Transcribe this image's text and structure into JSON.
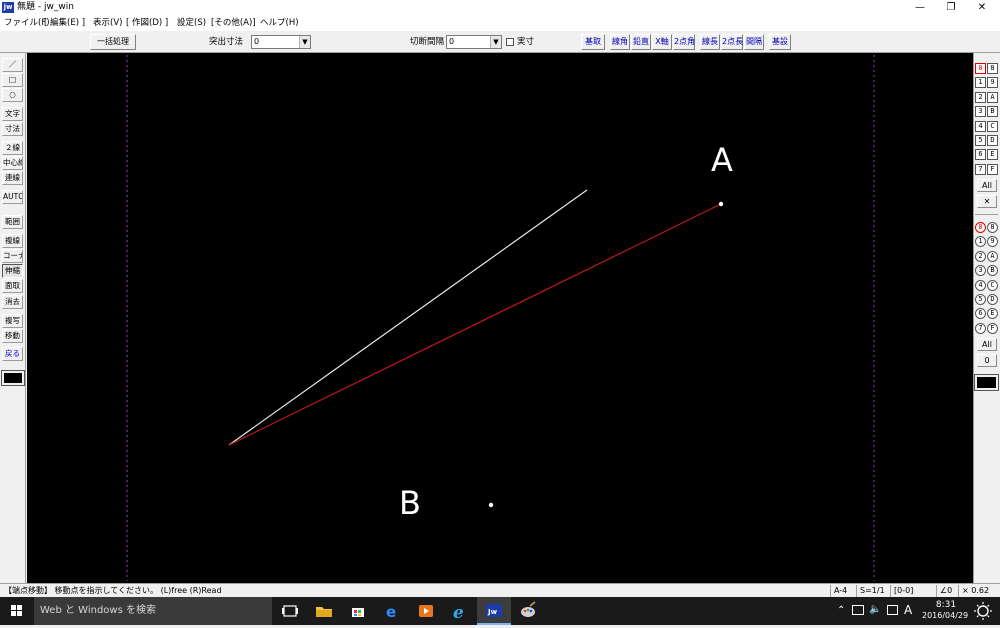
{
  "window": {
    "title": "無題 - jw_win",
    "app_icon_text": "jw",
    "controls": [
      "minimize-icon",
      "restore-icon",
      "close-icon"
    ]
  },
  "menu": [
    "ファイル(F)",
    "[ 編集(E) ]",
    "表示(V)",
    "[ 作図(D) ]",
    "設定(S)",
    "[その他(A)]",
    "ヘルプ(H)"
  ],
  "toolbar": {
    "batch_button": "一括処理",
    "protrusion_label": "突出寸法",
    "protrusion_value": "0",
    "interval_label": "切断間隔",
    "interval_value": "0",
    "actual_label": "実寸",
    "buttons": [
      "基取",
      "線角",
      "鉛直",
      "X軸",
      "2点角",
      "線長",
      "2点長",
      "間隔",
      "基設"
    ]
  },
  "left_tools": [
    {
      "label": "／",
      "icon": "line-icon"
    },
    {
      "label": "□",
      "icon": "rectangle-icon"
    },
    {
      "label": "○",
      "icon": "circle-icon"
    },
    {
      "label": "文字"
    },
    {
      "label": "寸法"
    },
    {
      "label": "２線"
    },
    {
      "label": "中心線"
    },
    {
      "label": "連線"
    },
    {
      "label": "AUTO"
    },
    {
      "label": "範囲"
    },
    {
      "label": "複線"
    },
    {
      "label": "コーナー"
    },
    {
      "label": "伸縮",
      "pressed": true
    },
    {
      "label": "面取"
    },
    {
      "label": "消去"
    },
    {
      "label": "複写"
    },
    {
      "label": "移動"
    },
    {
      "label": "戻る",
      "blue": true
    }
  ],
  "layer_rows": [
    [
      "0",
      "8"
    ],
    [
      "1",
      "9"
    ],
    [
      "2",
      "A"
    ],
    [
      "3",
      "B"
    ],
    [
      "4",
      "C"
    ],
    [
      "5",
      "D"
    ],
    [
      "6",
      "E"
    ],
    [
      "7",
      "F"
    ]
  ],
  "group_rows": [
    [
      "0",
      "8"
    ],
    [
      "1",
      "9"
    ],
    [
      "2",
      "A"
    ],
    [
      "3",
      "B"
    ],
    [
      "4",
      "C"
    ],
    [
      "5",
      "D"
    ],
    [
      "6",
      "E"
    ],
    [
      "7",
      "F"
    ]
  ],
  "layer_all": "All",
  "group_all": "All",
  "group_zero": "0",
  "canvas": {
    "label_a": "A",
    "label_b": "B",
    "white_line_color": "#e8e8e8",
    "red_line_color": "#c01818",
    "boundary_color": "#a040c0"
  },
  "status": {
    "message": "【端点移動】 移動点を指示してください。  (L)free  (R)Read",
    "paper": "A-4",
    "scale": "S=1/1",
    "layer": "[0-0]",
    "angle": "∠0",
    "zoom": "× 0.62"
  },
  "taskbar": {
    "search_placeholder": "Web と Windows を検索",
    "apps": [
      "task-view-icon",
      "file-explorer-icon",
      "store-icon",
      "edge-icon",
      "media-player-icon",
      "ie-icon",
      "jw-cad-icon",
      "paint-icon"
    ],
    "active_app": "jw-cad-icon",
    "time": "8:31",
    "date": "2016/04/29",
    "ime": "A"
  }
}
